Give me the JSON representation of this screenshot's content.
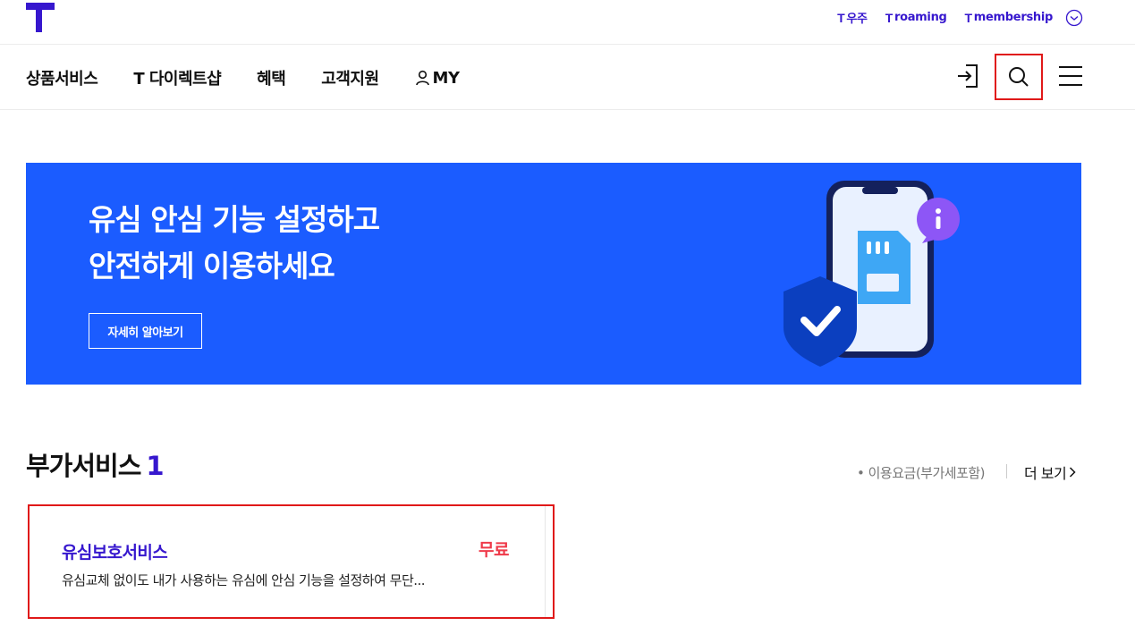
{
  "header": {
    "top_links": [
      {
        "mark": "T",
        "label": "우주"
      },
      {
        "mark": "T",
        "label": "roaming"
      },
      {
        "mark": "T",
        "label": "membership"
      }
    ]
  },
  "nav": {
    "items": [
      "상품서비스",
      "T 다이렉트샵",
      "혜택",
      "고객지원"
    ],
    "my_label": "MY"
  },
  "banner": {
    "title_line1": "유심 안심 기능 설정하고",
    "title_line2": "안전하게 이용하세요",
    "button_label": "자세히 알아보기",
    "background_color": "#1b5cff"
  },
  "section": {
    "title": "부가서비스",
    "count": "1",
    "note": "• 이용요금(부가세포함)",
    "more_label": "더 보기"
  },
  "cards": [
    {
      "title": "유심보호서비스",
      "price": "무료",
      "description": "유심교체 없이도 내가 사용하는 유심에 안심 기능을 설정하여 무단..."
    }
  ],
  "colors": {
    "brand": "#3617CE",
    "accent_red": "#ef3a4a",
    "highlight_border": "#e01919"
  }
}
